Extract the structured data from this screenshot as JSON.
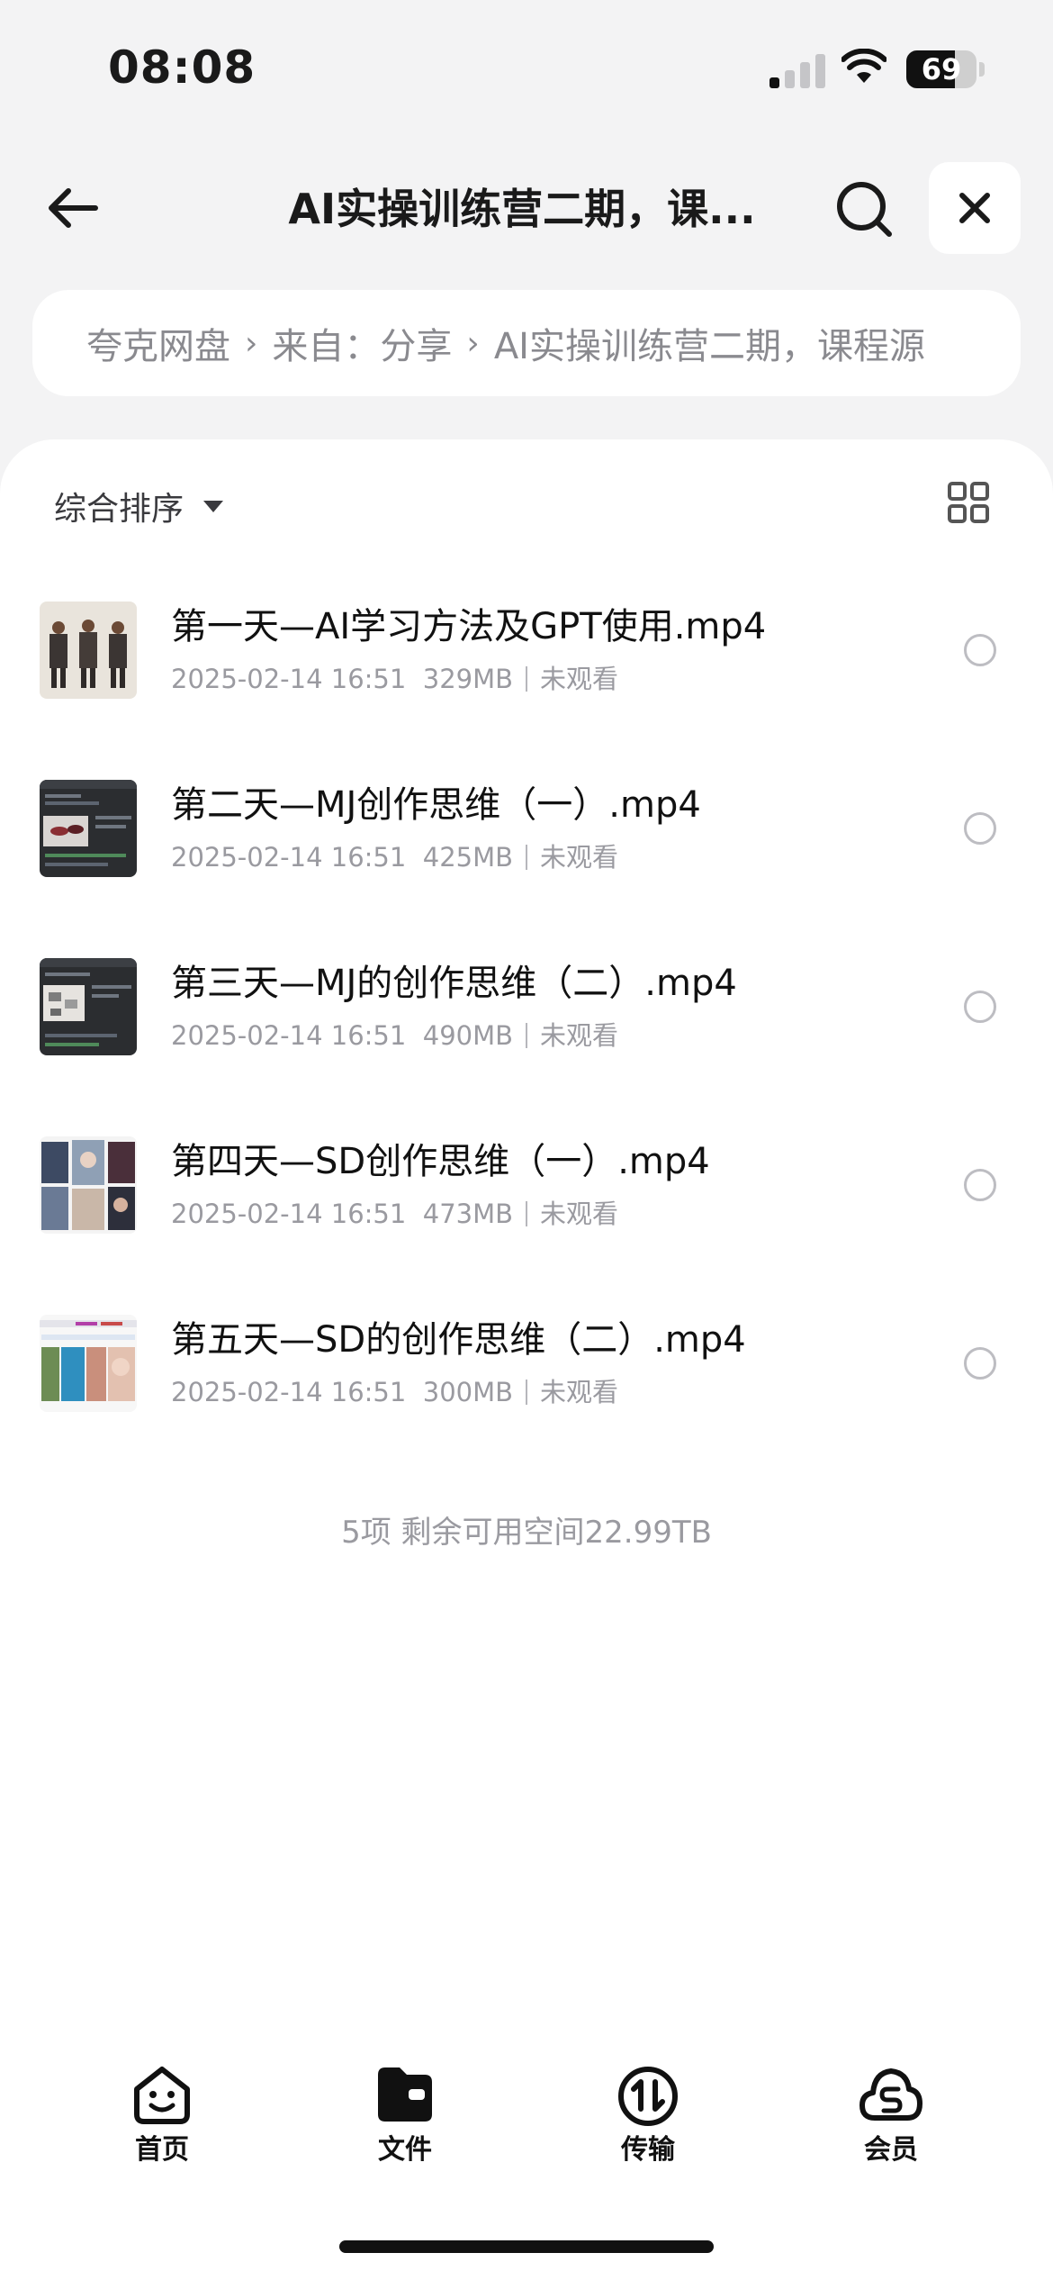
{
  "status_bar": {
    "time": "08:08",
    "battery_level": "69",
    "battery_fraction": 0.69,
    "signal_bars_active": 1,
    "icons": [
      "signal-icon",
      "wifi-icon",
      "battery-icon"
    ]
  },
  "nav": {
    "title": "AI实操训练营二期，课...",
    "icons": [
      "back-arrow-icon",
      "search-icon",
      "close-icon"
    ]
  },
  "breadcrumb": {
    "items": [
      "夸克网盘",
      "来自：分享",
      "AI实操训练营二期，课程源"
    ],
    "separator": "›"
  },
  "toolbar": {
    "sort_label": "综合排序",
    "icons": [
      "sort-caret-icon",
      "grid-view-icon"
    ]
  },
  "files": [
    {
      "name": "第一天—AI学习方法及GPT使用.mp4",
      "date": "2025-02-14 16:51",
      "size": "329MB",
      "status": "未观看",
      "thumb": "figures-thumbnail"
    },
    {
      "name": "第二天—MJ创作思维（一）.mp4",
      "date": "2025-02-14 16:51",
      "size": "425MB",
      "status": "未观看",
      "thumb": "dark-editor-thumbnail"
    },
    {
      "name": "第三天—MJ的创作思维（二）.mp4",
      "date": "2025-02-14 16:51",
      "size": "490MB",
      "status": "未观看",
      "thumb": "dark-editor-thumbnail"
    },
    {
      "name": "第四天—SD创作思维（一）.mp4",
      "date": "2025-02-14 16:51",
      "size": "473MB",
      "status": "未观看",
      "thumb": "image-collage-thumbnail"
    },
    {
      "name": "第五天—SD的创作思维（二）.mp4",
      "date": "2025-02-14 16:51",
      "size": "300MB",
      "status": "未观看",
      "thumb": "web-collage-thumbnail"
    }
  ],
  "summary": "5项 剩余可用空间22.99TB",
  "tabbar": {
    "tabs": [
      {
        "label": "首页",
        "icon": "smile-face-icon"
      },
      {
        "label": "文件",
        "icon": "folder-icon"
      },
      {
        "label": "传输",
        "icon": "transfer-icon"
      },
      {
        "label": "会员",
        "icon": "member-cloud-icon"
      }
    ],
    "active": 1
  },
  "colors": {
    "background": "#f3f3f4",
    "panel": "#ffffff",
    "secondary_text": "#9a9aa0",
    "primary_text": "#111111"
  }
}
